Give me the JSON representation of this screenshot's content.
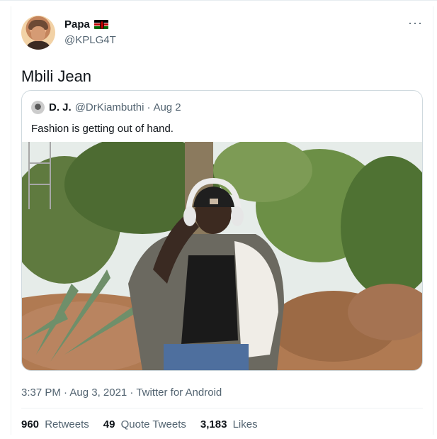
{
  "tweet": {
    "display_name": "Papa",
    "handle": "@KPLG4T",
    "text": "Mbili Jean",
    "more_icon": "more-horizontal-icon",
    "flag_icon": "kenya-flag-icon"
  },
  "quoted_tweet": {
    "display_name": "D. J.",
    "handle": "@DrKiambuthi",
    "separator": "·",
    "date": "Aug 2",
    "text": "Fashion is getting out of hand."
  },
  "footer": {
    "meta": "3:37 PM · Aug 3, 2021 · Twitter for Android",
    "stats": [
      {
        "count": "960",
        "label": "Retweets"
      },
      {
        "count": "49",
        "label": "Quote Tweets"
      },
      {
        "count": "3,183",
        "label": "Likes"
      }
    ]
  },
  "colors": {
    "text_primary": "#0f1419",
    "text_secondary": "#536471",
    "border": "#cfd9de"
  }
}
